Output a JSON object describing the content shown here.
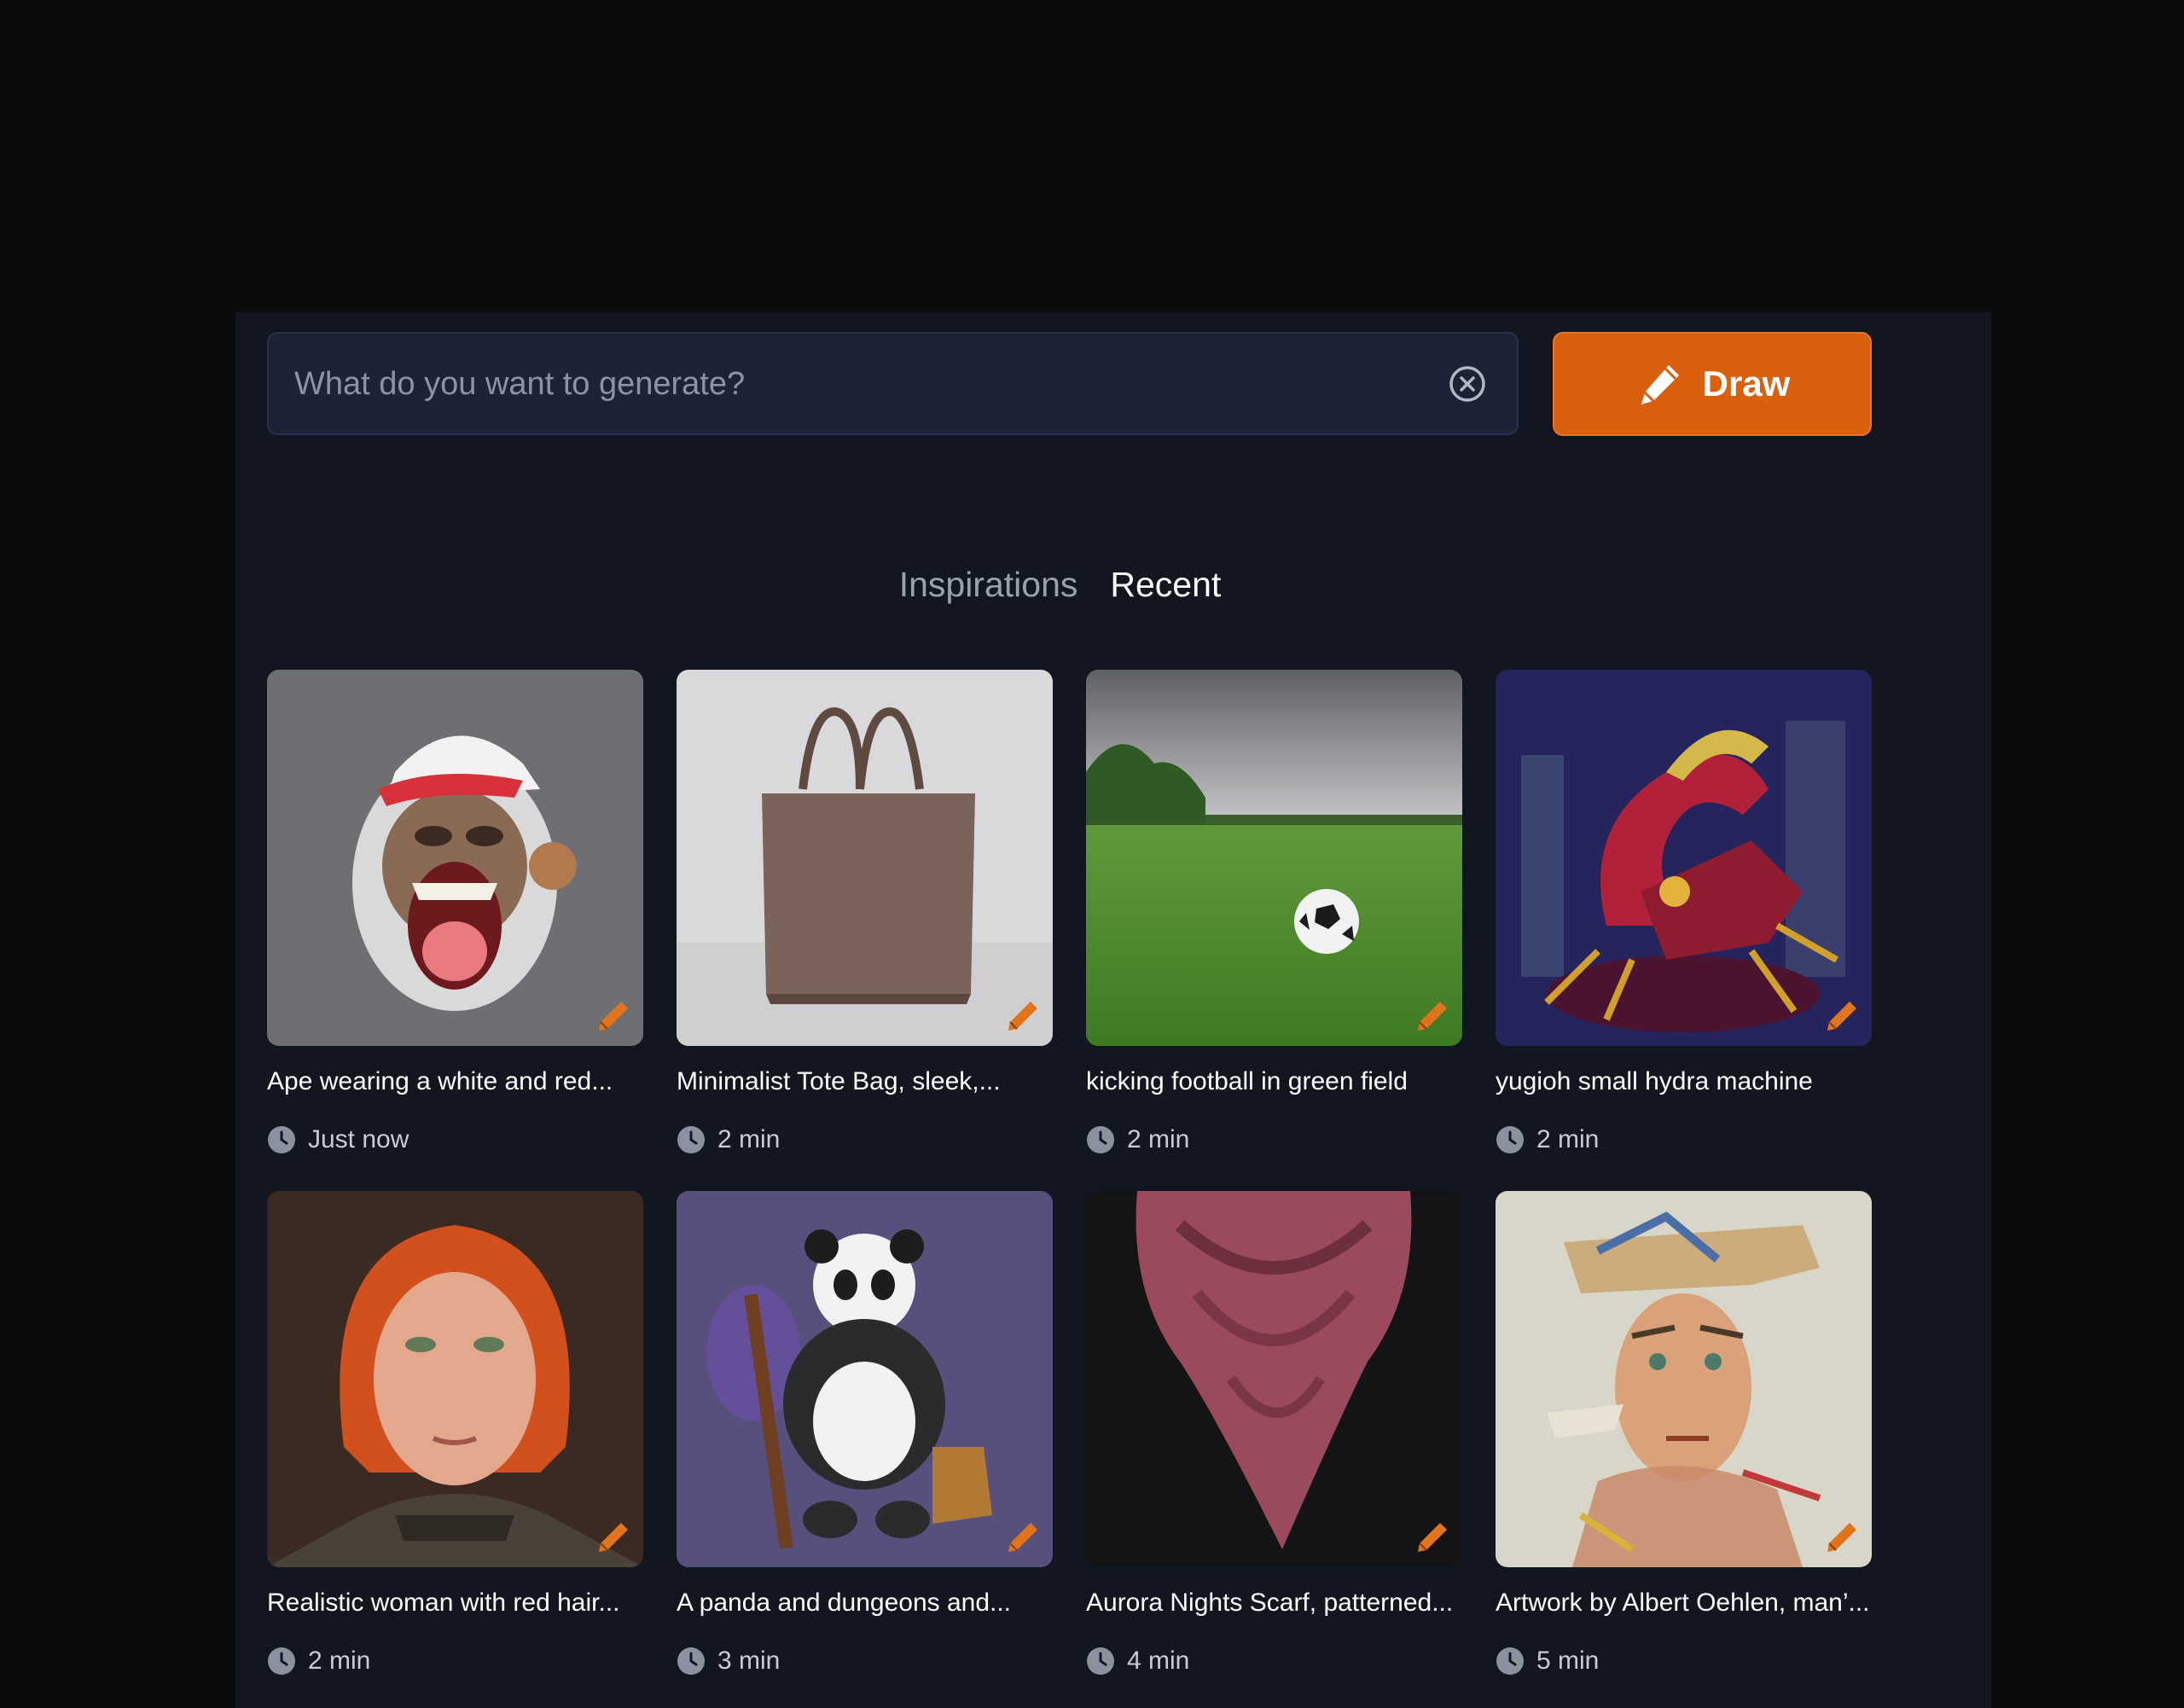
{
  "search": {
    "placeholder": "What do you want to generate?",
    "value": ""
  },
  "draw_button": {
    "label": "Draw"
  },
  "tabs": [
    {
      "label": "Inspirations",
      "active": false
    },
    {
      "label": "Recent",
      "active": true
    }
  ],
  "cards": [
    {
      "title": "Ape wearing a white and red...",
      "time": "Just now"
    },
    {
      "title": "Minimalist Tote Bag, sleek,...",
      "time": "2 min"
    },
    {
      "title": "kicking football in green field",
      "time": "2 min"
    },
    {
      "title": "yugioh small hydra machine",
      "time": "2 min"
    },
    {
      "title": "Realistic woman with red hair...",
      "time": "2 min"
    },
    {
      "title": "A panda and dungeons and...",
      "time": "3 min"
    },
    {
      "title": "Aurora Nights Scarf, patterned...",
      "time": "4 min"
    },
    {
      "title": "Artwork by Albert Oehlen, man’...",
      "time": "5 min"
    }
  ],
  "colors": {
    "accent": "#d8600f",
    "panel": "#111621",
    "page": "#0b0b0c"
  },
  "icons": {
    "clear": "close-circle-icon",
    "draw": "pencil-icon",
    "edit": "pencil-edit-icon",
    "time": "clock-icon"
  }
}
